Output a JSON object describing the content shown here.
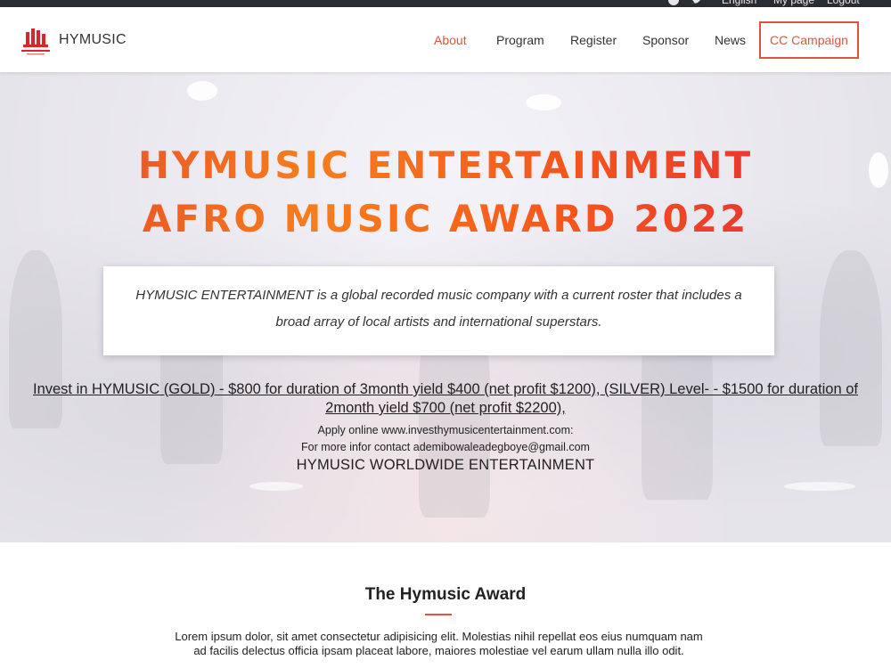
{
  "topbar": {
    "language": "English",
    "my_page": "My page",
    "logout": "Logout"
  },
  "header": {
    "brand": "HYMUSIC",
    "nav": [
      {
        "label": "About",
        "active": true
      },
      {
        "label": "Program",
        "active": false
      },
      {
        "label": "Register",
        "active": false
      },
      {
        "label": "Sponsor",
        "active": false
      },
      {
        "label": "News",
        "active": false
      },
      {
        "label": "CC Campaign",
        "active": false
      }
    ]
  },
  "hero": {
    "title_line1": "HYMUSIC ENTERTAINMENT",
    "title_line2": "AFRO MUSIC AWARD 2022",
    "intro": "HYMUSIC ENTERTAINMENT is a global recorded music company with a current roster that includes a broad array of local artists and international superstars.",
    "invest_link": "Invest in HYMUSIC (GOLD) - $800 for duration of 3month yield $400 (net profit $1200), (SILVER) Level- - $1500 for duration of 2month yield $700 (net profit $2200),",
    "apply": "Apply online www.investhymusicentertainment.com:",
    "contact": "For more infor contact ademibowaleadegboye@gmail.com",
    "worldwide": "HYMUSIC WORLDWIDE ENTERTAINMENT"
  },
  "about": {
    "title": "The Hymusic Award",
    "text": "Lorem ipsum dolor, sit amet consectetur adipisicing elit. Molestias nihil repellat eos eius numquam nam ad facilis delectus officia ipsam placeat labore, maiores molestiae vel earum ullam nulla illo odit."
  },
  "colors": {
    "accent": "#e0543f",
    "topbar": "#2b2d35"
  },
  "icons": [
    "facebook-icon",
    "twitter-icon",
    "logo-icon"
  ]
}
